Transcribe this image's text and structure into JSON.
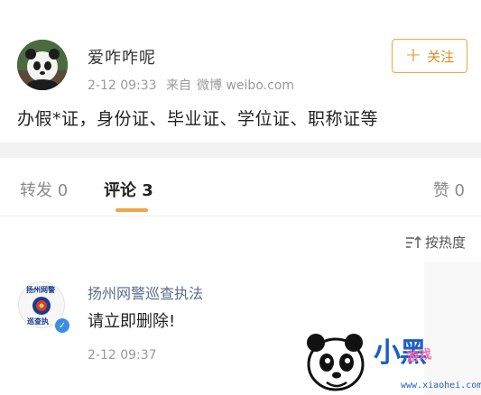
{
  "post": {
    "author": "爱咋咋呢",
    "time": "2-12 09:33",
    "source_prefix": "来自",
    "source": "微博 weibo.com",
    "follow_label": "关注",
    "text": "办假*证，身份证、毕业证、学位证、职称证等"
  },
  "tabs": {
    "repost": "转发 0",
    "comment": "评论 3",
    "like": "赞 0"
  },
  "sort": {
    "label": "按热度",
    "icon": "sort-icon"
  },
  "comment": {
    "author": "扬州网警巡查执法",
    "text": "请立即删除!",
    "time": "2-12 09:37",
    "badge_top": "扬州网警",
    "badge_bottom": "巡查执"
  },
  "watermark": {
    "brand": "小黑",
    "sub": "游戏",
    "url": "www.xiaohei.com"
  },
  "colors": {
    "accent": "#f0a646",
    "link": "#5b6b8c",
    "verified": "#3a8ee6"
  }
}
